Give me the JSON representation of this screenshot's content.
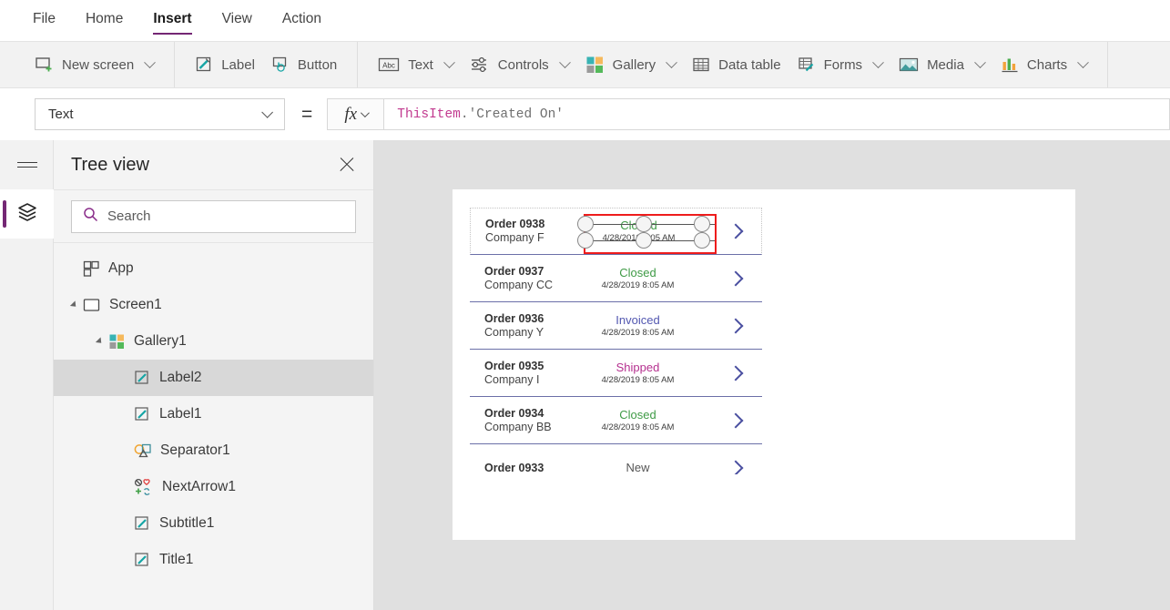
{
  "menubar": {
    "items": [
      {
        "label": "File",
        "active": false
      },
      {
        "label": "Home",
        "active": false
      },
      {
        "label": "Insert",
        "active": true
      },
      {
        "label": "View",
        "active": false
      },
      {
        "label": "Action",
        "active": false
      }
    ],
    "accent_color": "#742774"
  },
  "ribbon": {
    "groups": [
      {
        "items": [
          {
            "label": "New screen",
            "icon": "new-screen-icon",
            "caret": true
          }
        ]
      },
      {
        "items": [
          {
            "label": "Label",
            "icon": "label-icon",
            "caret": false
          },
          {
            "label": "Button",
            "icon": "button-icon",
            "caret": false
          }
        ]
      },
      {
        "items": [
          {
            "label": "Text",
            "icon": "text-abc-icon",
            "caret": true
          },
          {
            "label": "Controls",
            "icon": "controls-icon",
            "caret": true
          },
          {
            "label": "Gallery",
            "icon": "gallery-icon",
            "caret": true
          },
          {
            "label": "Data table",
            "icon": "data-table-icon",
            "caret": false
          },
          {
            "label": "Forms",
            "icon": "forms-icon",
            "caret": true
          },
          {
            "label": "Media",
            "icon": "media-icon",
            "caret": true
          },
          {
            "label": "Charts",
            "icon": "charts-icon",
            "caret": true
          }
        ]
      }
    ]
  },
  "formula_bar": {
    "property_selected": "Text",
    "equals": "=",
    "fx_label": "fx",
    "formula_identifier": "ThisItem",
    "formula_rest": ".'Created On'"
  },
  "rail": {
    "menu_icon": "hamburger-icon",
    "tree_tab_icon": "layers-icon"
  },
  "tree_panel": {
    "title": "Tree view",
    "close_icon": "close-icon",
    "search_placeholder": "Search",
    "search_value": "",
    "search_icon": "search-icon",
    "items": [
      {
        "label": "App",
        "icon": "app-icon",
        "depth": 0,
        "caret": false,
        "selected": false
      },
      {
        "label": "Screen1",
        "icon": "screen-icon",
        "depth": 0,
        "caret": true,
        "selected": false
      },
      {
        "label": "Gallery1",
        "icon": "gallery-icon",
        "depth": 1,
        "caret": true,
        "selected": false
      },
      {
        "label": "Label2",
        "icon": "label-icon",
        "depth": 2,
        "caret": false,
        "selected": true
      },
      {
        "label": "Label1",
        "icon": "label-icon",
        "depth": 2,
        "caret": false,
        "selected": false
      },
      {
        "label": "Separator1",
        "icon": "separator-icon",
        "depth": 2,
        "caret": false,
        "selected": false
      },
      {
        "label": "NextArrow1",
        "icon": "icons-group-icon",
        "depth": 2,
        "caret": false,
        "selected": false
      },
      {
        "label": "Subtitle1",
        "icon": "label-icon",
        "depth": 2,
        "caret": false,
        "selected": false
      },
      {
        "label": "Title1",
        "icon": "label-icon",
        "depth": 2,
        "caret": false,
        "selected": false
      }
    ]
  },
  "canvas": {
    "background_color": "#e0e0e0",
    "screen_color": "#ffffff",
    "status_colors": {
      "Closed": "#3f9b46",
      "Invoiced": "#5257b0",
      "Shipped": "#b5308f",
      "New": "#555555"
    },
    "selection": {
      "border_color": "#ee1c1c",
      "target_control": "Label2"
    },
    "gallery": {
      "rows": [
        {
          "title": "Order 0938",
          "subtitle": "Company F",
          "status": "Closed",
          "date": "4/28/2019 8:05 AM",
          "selected": true,
          "arrow": "chevron-right-icon"
        },
        {
          "title": "Order 0937",
          "subtitle": "Company CC",
          "status": "Closed",
          "date": "4/28/2019 8:05 AM",
          "selected": false,
          "arrow": "chevron-right-icon"
        },
        {
          "title": "Order 0936",
          "subtitle": "Company Y",
          "status": "Invoiced",
          "date": "4/28/2019 8:05 AM",
          "selected": false,
          "arrow": "chevron-right-icon"
        },
        {
          "title": "Order 0935",
          "subtitle": "Company I",
          "status": "Shipped",
          "date": "4/28/2019 8:05 AM",
          "selected": false,
          "arrow": "chevron-right-icon"
        },
        {
          "title": "Order 0934",
          "subtitle": "Company BB",
          "status": "Closed",
          "date": "4/28/2019 8:05 AM",
          "selected": false,
          "arrow": "chevron-right-icon"
        },
        {
          "title": "Order 0933",
          "subtitle": "",
          "status": "New",
          "date": "",
          "selected": false,
          "arrow": "chevron-right-icon"
        }
      ]
    }
  }
}
